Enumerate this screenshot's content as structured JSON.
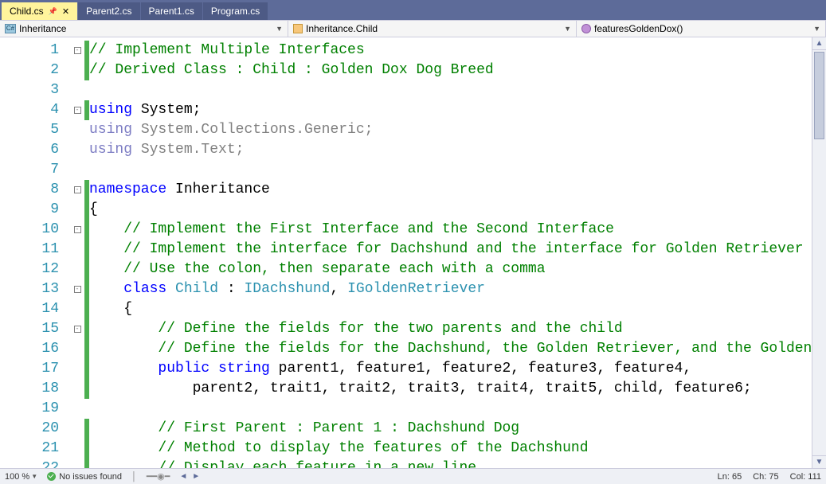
{
  "tabs": [
    {
      "label": "Child.cs",
      "active": true
    },
    {
      "label": "Parent2.cs",
      "active": false
    },
    {
      "label": "Parent1.cs",
      "active": false
    },
    {
      "label": "Program.cs",
      "active": false
    }
  ],
  "nav": {
    "scope": "Inheritance",
    "class": "Inheritance.Child",
    "member": "featuresGoldenDox()"
  },
  "first_line": 1,
  "code_lines": [
    [
      [
        "comment",
        "// Implement Multiple Interfaces"
      ]
    ],
    [
      [
        "comment",
        "// Derived Class : Child : Golden Dox Dog Breed"
      ]
    ],
    [],
    [
      [
        "kw",
        "using"
      ],
      [
        "txt",
        " System;"
      ]
    ],
    [
      [
        "kwdim",
        "using"
      ],
      [
        "dim",
        " System.Collections.Generic;"
      ]
    ],
    [
      [
        "kwdim",
        "using"
      ],
      [
        "dim",
        " System.Text;"
      ]
    ],
    [],
    [
      [
        "kw",
        "namespace"
      ],
      [
        "txt",
        " Inheritance"
      ]
    ],
    [
      [
        "txt",
        "{"
      ]
    ],
    [
      [
        "txt",
        "    "
      ],
      [
        "comment",
        "// Implement the First Interface and the Second Interface"
      ]
    ],
    [
      [
        "txt",
        "    "
      ],
      [
        "comment",
        "// Implement the interface for Dachshund and the interface for Golden Retriever"
      ]
    ],
    [
      [
        "txt",
        "    "
      ],
      [
        "comment",
        "// Use the colon, then separate each with a comma"
      ]
    ],
    [
      [
        "txt",
        "    "
      ],
      [
        "kw",
        "class"
      ],
      [
        "txt",
        " "
      ],
      [
        "type",
        "Child"
      ],
      [
        "txt",
        " : "
      ],
      [
        "type",
        "IDachshund"
      ],
      [
        "txt",
        ", "
      ],
      [
        "type",
        "IGoldenRetriever"
      ]
    ],
    [
      [
        "txt",
        "    {"
      ]
    ],
    [
      [
        "txt",
        "        "
      ],
      [
        "comment",
        "// Define the fields for the two parents and the child"
      ]
    ],
    [
      [
        "txt",
        "        "
      ],
      [
        "comment",
        "// Define the fields for the Dachshund, the Golden Retriever, and the Golden Dox"
      ]
    ],
    [
      [
        "txt",
        "        "
      ],
      [
        "kw",
        "public"
      ],
      [
        "txt",
        " "
      ],
      [
        "kw",
        "string"
      ],
      [
        "txt",
        " parent1, feature1, feature2, feature3, feature4,"
      ]
    ],
    [
      [
        "txt",
        "            parent2, trait1, trait2, trait3, trait4, trait5, child, feature6;"
      ]
    ],
    [],
    [
      [
        "txt",
        "        "
      ],
      [
        "comment",
        "// First Parent : Parent 1 : Dachshund Dog"
      ]
    ],
    [
      [
        "txt",
        "        "
      ],
      [
        "comment",
        "// Method to display the features of the Dachshund"
      ]
    ],
    [
      [
        "txt",
        "        "
      ],
      [
        "comment",
        "// Display each feature in a new line"
      ]
    ]
  ],
  "fold_marks": {
    "1": "minus",
    "4": "minus",
    "8": "minus",
    "10": "minus",
    "13": "minus",
    "15": "minus"
  },
  "change_marks": [
    1,
    2,
    4,
    8,
    9,
    10,
    11,
    12,
    13,
    14,
    15,
    16,
    17,
    18,
    20,
    21,
    22
  ],
  "status": {
    "zoom": "100 %",
    "issues": "No issues found",
    "ln": "Ln: 65",
    "ch": "Ch: 75",
    "col": "Col: 111"
  }
}
